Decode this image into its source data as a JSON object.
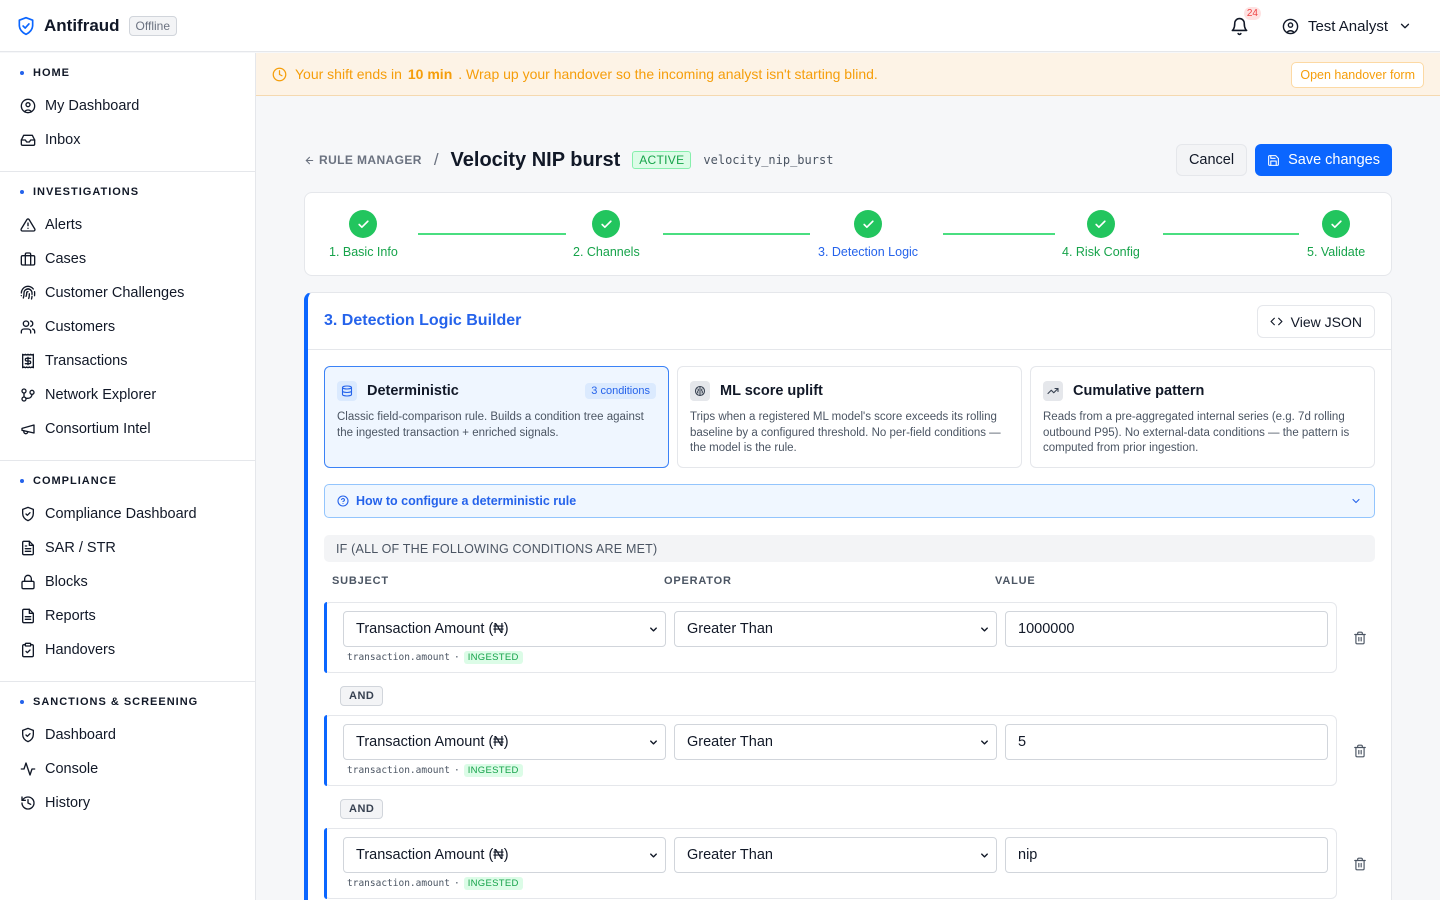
{
  "app": {
    "name": "Antifraud",
    "status": "Offline"
  },
  "topbar": {
    "notification_count": "24",
    "user_name": "Test Analyst"
  },
  "sidebar": {
    "sections": [
      {
        "title": "HOME",
        "items": [
          {
            "label": "My Dashboard",
            "icon": "user-circle-icon"
          },
          {
            "label": "Inbox",
            "icon": "inbox-icon"
          }
        ]
      },
      {
        "title": "INVESTIGATIONS",
        "items": [
          {
            "label": "Alerts",
            "icon": "alert-triangle-icon"
          },
          {
            "label": "Cases",
            "icon": "briefcase-icon"
          },
          {
            "label": "Customer Challenges",
            "icon": "fingerprint-icon"
          },
          {
            "label": "Customers",
            "icon": "users-icon"
          },
          {
            "label": "Transactions",
            "icon": "receipt-icon"
          },
          {
            "label": "Network Explorer",
            "icon": "git-branch-icon"
          },
          {
            "label": "Consortium Intel",
            "icon": "megaphone-icon"
          }
        ]
      },
      {
        "title": "COMPLIANCE",
        "items": [
          {
            "label": "Compliance Dashboard",
            "icon": "shield-check-icon"
          },
          {
            "label": "SAR / STR",
            "icon": "file-text-icon"
          },
          {
            "label": "Blocks",
            "icon": "lock-icon"
          },
          {
            "label": "Reports",
            "icon": "file-icon"
          },
          {
            "label": "Handovers",
            "icon": "clipboard-check-icon"
          }
        ]
      },
      {
        "title": "SANCTIONS & SCREENING",
        "items": [
          {
            "label": "Dashboard",
            "icon": "shield-check-icon"
          },
          {
            "label": "Console",
            "icon": "activity-icon"
          },
          {
            "label": "History",
            "icon": "history-icon"
          }
        ]
      }
    ]
  },
  "banner": {
    "text_before": "Your shift ends in",
    "time": "10 min",
    "text_after": ". Wrap up your handover so the incoming analyst isn't starting blind.",
    "button": "Open handover form"
  },
  "header": {
    "breadcrumb": "RULE MANAGER",
    "separator": "/",
    "rule_name": "Velocity NIP burst",
    "status": "ACTIVE",
    "slug": "velocity_nip_burst",
    "cancel_label": "Cancel",
    "save_label": "Save changes"
  },
  "steps": [
    {
      "label": "1. Basic Info",
      "state": "complete"
    },
    {
      "label": "2. Channels",
      "state": "complete"
    },
    {
      "label": "3. Detection Logic",
      "state": "current"
    },
    {
      "label": "4. Risk Config",
      "state": "complete"
    },
    {
      "label": "5. Validate",
      "state": "complete"
    }
  ],
  "builder": {
    "title": "3. Detection Logic Builder",
    "view_json_label": "View JSON",
    "types": [
      {
        "name": "Deterministic",
        "badge": "3 conditions",
        "selected": true,
        "description": "Classic field-comparison rule. Builds a condition tree against the ingested transaction + enriched signals."
      },
      {
        "name": "ML score uplift",
        "selected": false,
        "description": "Trips when a registered ML model's score exceeds its rolling baseline by a configured threshold. No per-field conditions — the model is the rule."
      },
      {
        "name": "Cumulative pattern",
        "selected": false,
        "description": "Reads from a pre-aggregated internal series (e.g. 7d rolling outbound P95). No external-data conditions — the pattern is computed from prior ingestion."
      }
    ],
    "howto_label": "How to configure a deterministic rule",
    "if_label": "IF (ALL OF THE FOLLOWING CONDITIONS ARE MET)",
    "columns": {
      "subject": "SUBJECT",
      "operator": "OPERATOR",
      "value": "VALUE"
    },
    "join_label": "AND",
    "conditions": [
      {
        "subject": "Transaction Amount (₦)",
        "operator": "Greater Than",
        "value": "1000000",
        "field": "transaction.amount",
        "source": "INGESTED"
      },
      {
        "subject": "Transaction Amount (₦)",
        "operator": "Greater Than",
        "value": "5",
        "field": "transaction.amount",
        "source": "INGESTED"
      },
      {
        "subject": "Transaction Amount (₦)",
        "operator": "Greater Than",
        "value": "nip",
        "field": "transaction.amount",
        "source": "INGESTED"
      }
    ]
  },
  "colors": {
    "primary": "#0b66ff",
    "success": "#22c55e",
    "warning": "#f59e0b",
    "danger": "#ef4444"
  }
}
